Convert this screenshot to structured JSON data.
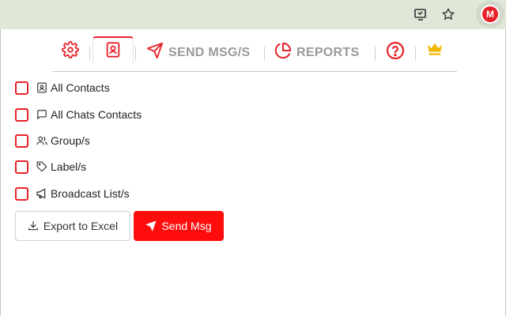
{
  "browser": {
    "icons": [
      "cast-install-icon",
      "star-bookmark-icon"
    ],
    "profile_letter": "M"
  },
  "nav": {
    "items": [
      {
        "name": "settings",
        "icon": "gear-icon",
        "label": ""
      },
      {
        "name": "contacts",
        "icon": "contact-book-icon",
        "label": "",
        "active": true
      },
      {
        "name": "send",
        "icon": "paper-plane-icon",
        "label": "SEND MSG/S"
      },
      {
        "name": "reports",
        "icon": "pie-chart-icon",
        "label": "REPORTS"
      },
      {
        "name": "help",
        "icon": "question-circle-icon",
        "label": ""
      },
      {
        "name": "premium",
        "icon": "crown-icon",
        "label": ""
      }
    ]
  },
  "options": [
    {
      "label": "All Contacts",
      "icon": "contact-card-icon",
      "checked": false
    },
    {
      "label": "All Chats Contacts",
      "icon": "chat-bubble-icon",
      "checked": false
    },
    {
      "label": "Group/s",
      "icon": "users-icon",
      "checked": false
    },
    {
      "label": "Label/s",
      "icon": "tag-icon",
      "checked": false
    },
    {
      "label": "Broadcast List/s",
      "icon": "megaphone-icon",
      "checked": false
    }
  ],
  "actions": {
    "export_label": "Export to Excel",
    "send_label": "Send Msg"
  },
  "colors": {
    "accent": "#e8222a",
    "send_button": "#ff0d0d",
    "browser_bar": "#dfe7d9",
    "crown": "#f2b705"
  }
}
